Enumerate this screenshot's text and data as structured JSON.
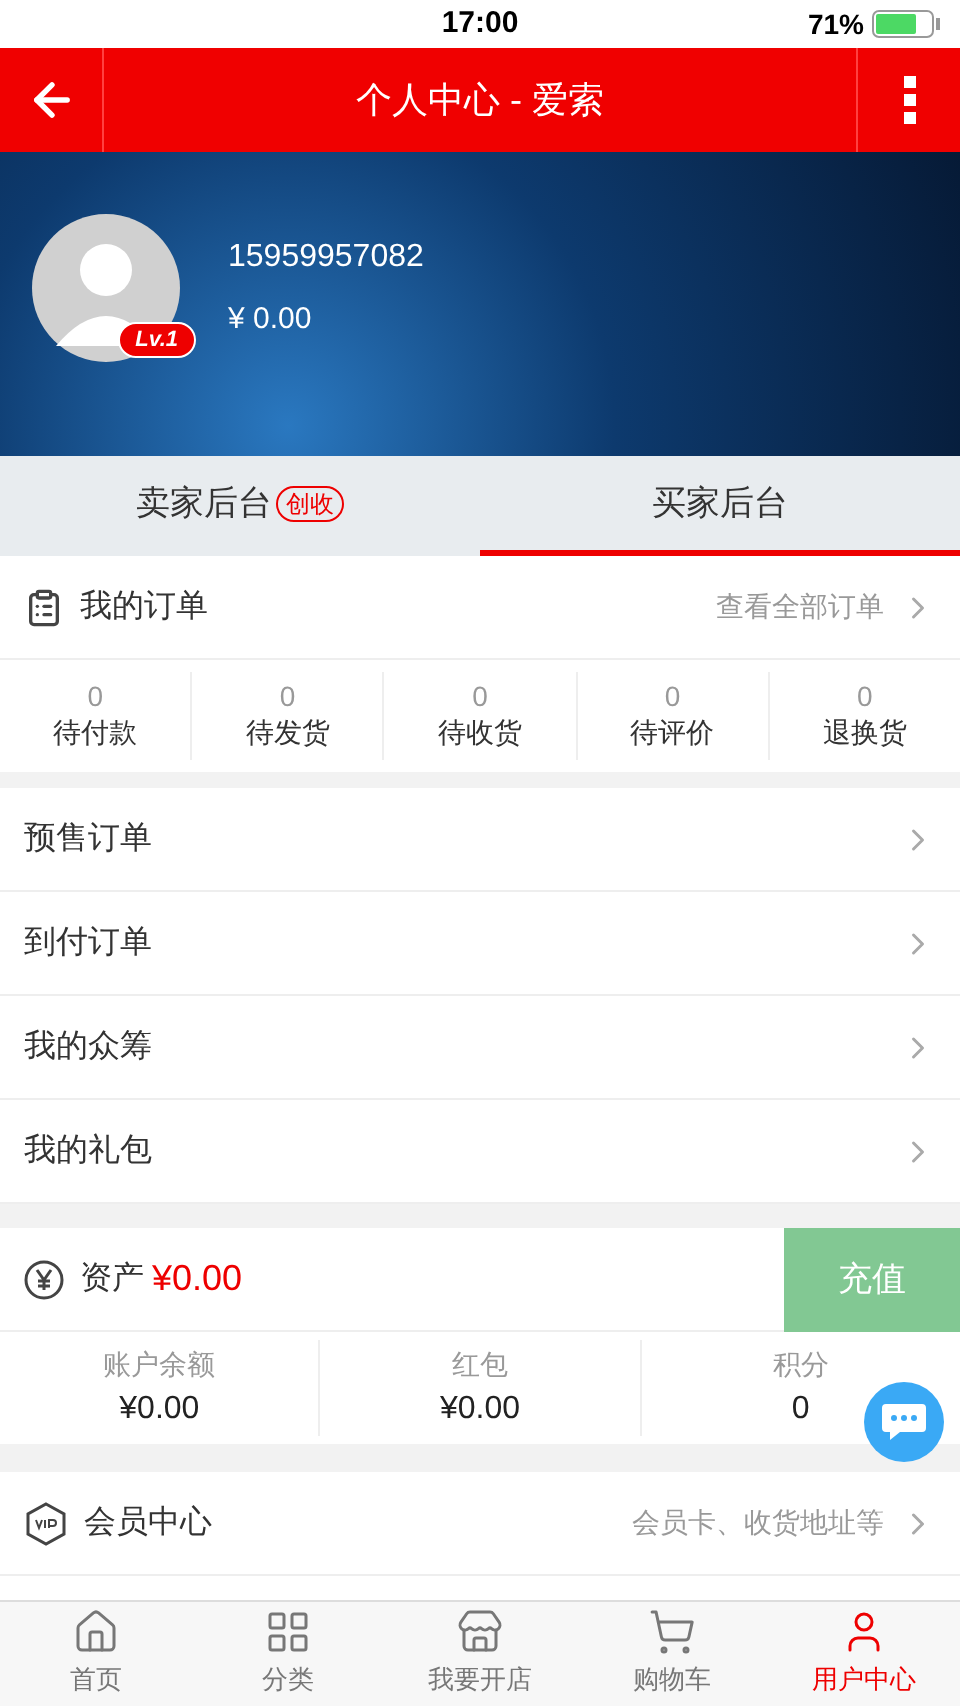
{
  "status_bar": {
    "time": "17:00",
    "battery": "71%"
  },
  "header": {
    "title": "个人中心 - 爱索"
  },
  "profile": {
    "phone": "15959957082",
    "balance": "¥ 0.00",
    "level": "Lv.1"
  },
  "tabs": [
    {
      "label": "卖家后台",
      "badge": "创收",
      "selected": false
    },
    {
      "label": "买家后台",
      "selected": true
    }
  ],
  "orders": {
    "title": "我的订单",
    "link": "查看全部订单",
    "counts": [
      {
        "value": "0",
        "label": "待付款"
      },
      {
        "value": "0",
        "label": "待发货"
      },
      {
        "value": "0",
        "label": "待收货"
      },
      {
        "value": "0",
        "label": "待评价"
      },
      {
        "value": "0",
        "label": "退换货"
      }
    ]
  },
  "menu": [
    "预售订单",
    "到付订单",
    "我的众筹",
    "我的礼包"
  ],
  "assets": {
    "label": "资产",
    "amount": "¥0.00",
    "button": "充值",
    "items": [
      {
        "label": "账户余额",
        "value": "¥0.00"
      },
      {
        "label": "红包",
        "value": "¥0.00"
      },
      {
        "label": "积分",
        "value": "0"
      }
    ]
  },
  "member": {
    "title": "会员中心",
    "hint": "会员卡、收货地址等"
  },
  "nav": [
    {
      "label": "首页",
      "kind": "home",
      "selected": false
    },
    {
      "label": "分类",
      "kind": "category",
      "selected": false
    },
    {
      "label": "我要开店",
      "kind": "shop",
      "selected": false
    },
    {
      "label": "购物车",
      "kind": "cart",
      "selected": false
    },
    {
      "label": "用户中心",
      "kind": "user",
      "selected": true
    }
  ]
}
